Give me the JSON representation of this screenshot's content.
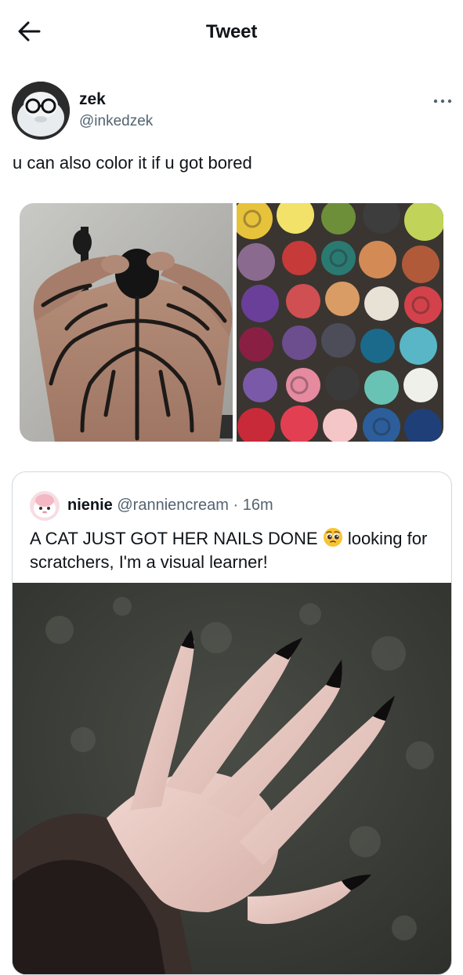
{
  "header": {
    "title": "Tweet"
  },
  "icons": {
    "back": "arrow-left-icon",
    "more": "more-horizontal-icon",
    "emoji": "pleading-face-emoji"
  },
  "tweet": {
    "author_name": "zek",
    "author_handle": "@inkedzek",
    "text": "u can also color it if u got bored"
  },
  "quoted_tweet": {
    "author_name": "nienie",
    "author_handle": "@ranniencream",
    "separator": "·",
    "time": "16m",
    "text_before_emoji": "A CAT JUST GOT HER NAILS DONE",
    "text_after_emoji": "looking for scratchers, I'm a visual learner!"
  },
  "colors": {
    "text_primary": "#0f1419",
    "text_secondary": "#536471",
    "border": "#cfd9de"
  }
}
